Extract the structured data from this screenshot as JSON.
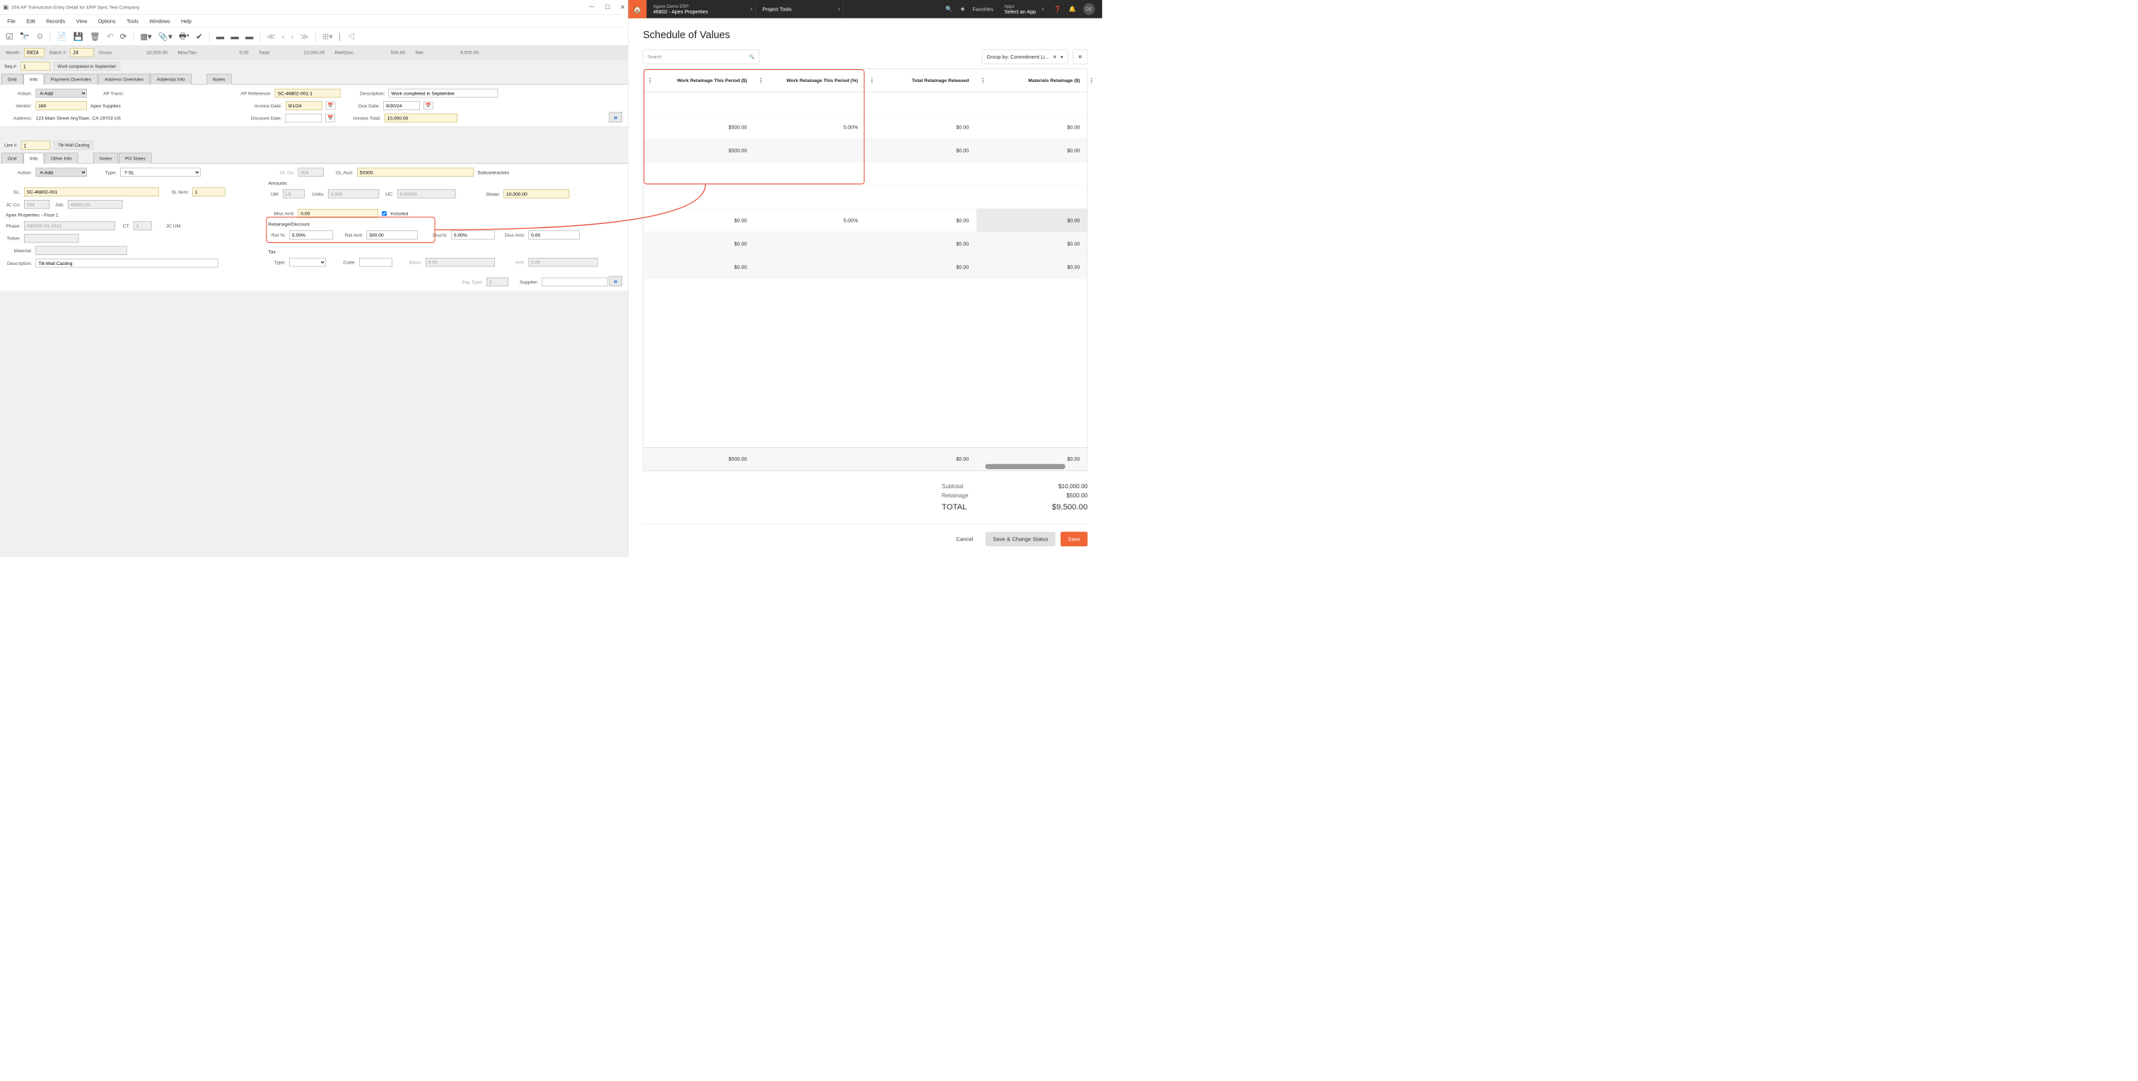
{
  "erp": {
    "window_title": "204 AP Transaction Entry Detail for ERP Sync Test Company",
    "menu": [
      "File",
      "Edit",
      "Records",
      "View",
      "Options",
      "Tools",
      "Windows",
      "Help"
    ],
    "summary": {
      "month_label": "Month:",
      "month": "09/24",
      "batch_label": "Batch #:",
      "batch": "24",
      "gross_label": "Gross:",
      "gross": "10,000.00",
      "misctax_label": "Misc/Tax:",
      "misctax": "0.00",
      "total_label": "Total:",
      "total": "10,000.00",
      "retdisc_label": "Ret/Disc:",
      "retdisc": "500.00",
      "net_label": "Net:",
      "net": "9,500.00"
    },
    "seq": {
      "label": "Seq #:",
      "value": "1",
      "desc": "Work completed in September"
    },
    "tabs1": [
      "Grid",
      "Info",
      "Payment Overrides",
      "Address Overrides",
      "Addenda Info",
      "Notes"
    ],
    "header_form": {
      "action_label": "Action:",
      "action": "A-Add",
      "aptrans_label": "AP Trans:",
      "vendor_label": "Vendor:",
      "vendor": "160",
      "vendor_name": "Apex Supplies",
      "address_label": "Address:",
      "address": "123 Main Street  AnyTown,  CA  19703  US",
      "apref_label": "AP Reference:",
      "apref": "SC-46802-001-1",
      "inv_date_label": "Invoice Date:",
      "inv_date": "9/1/24",
      "disc_date_label": "Discount Date:",
      "desc_label": "Description:",
      "desc": "Work completed in September",
      "due_date_label": "Due Date:",
      "due_date": "9/30/24",
      "inv_total_label": "Invoice Total:",
      "inv_total": "10,000.00"
    },
    "line": {
      "label": "Line #:",
      "value": "1",
      "desc": "Tilt-Wall Casting"
    },
    "tabs2": [
      "Grid",
      "Info",
      "Other Info",
      "Notes",
      "PO Notes"
    ],
    "line_form": {
      "action_label": "Action:",
      "action": "A-Add",
      "type_label": "Type:",
      "type": "7-SL",
      "sl_label": "SL:",
      "sl": "SC-46802-001",
      "sl_item_label": "SL Item:",
      "sl_item": "1",
      "jcco_label": "JC Co:",
      "jcco": "204",
      "job_label": "Job:",
      "job": "46802-01",
      "project": "Apex Properties - Floor 1",
      "phase_label": "Phase:",
      "phase": "030000-01-2012",
      "ct_label": "CT:",
      "ct": "1",
      "jcum_label": "JC UM:",
      "ticket_label": "Ticket:",
      "material_label": "Material:",
      "description_label": "Description:",
      "description": "Tilt-Wall Casting",
      "glco_label": "GL Co:",
      "glco": "204",
      "glacct_label": "GL Acct:",
      "glacct": "50300.",
      "gl_desc": "Subcontractors",
      "amounts_label": "Amounts",
      "um_label": "UM:",
      "um": "LS",
      "units_label": "Units:",
      "units": "0.000",
      "uc_label": "UC:",
      "uc": "0.00000",
      "gross_label": "Gross:",
      "gross": "10,000.00",
      "miscamt_label": "Misc Amt:",
      "miscamt": "0.00",
      "included_label": "Included",
      "retdisc_label": "Retainage/Discount",
      "retpct_label": "Ret %:",
      "retpct": "5.00%",
      "retamt_label": "Ret Amt:",
      "retamt": "500.00",
      "discpct_label": "Disc%:",
      "discpct": "0.00%",
      "discamt_label": "Disc Amt:",
      "discamt": "0.00",
      "tax_label": "Tax",
      "taxtype_label": "Type:",
      "code_label": "Code:",
      "basis_label": "Basis:",
      "basis": "0.00",
      "amt_label": "Amt:",
      "amt": "0.00",
      "paytype_label": "Pay Type:",
      "paytype": "3",
      "supplier_label": "Supplier:"
    }
  },
  "web": {
    "erp_name": "Agave Demo ERP",
    "context": "46802 - Apex Properties",
    "project_tools": "Project Tools",
    "favorites": "Favorites",
    "apps_label": "Apps",
    "apps_value": "Select an App",
    "avatar": "DE",
    "page_title": "Schedule of Values",
    "search_placeholder": "Search",
    "group_label": "Group by: Commitment Li...",
    "cols": [
      "Work Retainage This Period ($)",
      "Work Retainage This Period (%)",
      "Total Retainage Released",
      "Materials Retainage ($)"
    ],
    "rows": [
      [
        "",
        "",
        "",
        ""
      ],
      [
        "$500.00",
        "5.00%",
        "$0.00",
        "$0.00"
      ],
      [
        "$500.00",
        "",
        "$0.00",
        "$0.00"
      ],
      [
        "",
        "",
        "",
        ""
      ],
      [
        "",
        "",
        "",
        ""
      ],
      [
        "$0.00",
        "5.00%",
        "$0.00",
        "$0.00"
      ],
      [
        "$0.00",
        "",
        "$0.00",
        "$0.00"
      ],
      [
        "$0.00",
        "",
        "$0.00",
        "$0.00"
      ]
    ],
    "row_classes": [
      "",
      "",
      "total",
      "",
      "",
      "highlight",
      "total",
      "total"
    ],
    "footer_row": [
      "$500.00",
      "",
      "$0.00",
      "$0.00"
    ],
    "subtotal_label": "Subtotal",
    "subtotal": "$10,000.00",
    "retainage_label": "Retainage",
    "retainage": "$500.00",
    "total_label": "TOTAL",
    "total": "$9,500.00",
    "cancel": "Cancel",
    "save_change": "Save & Change Status",
    "save": "Save"
  }
}
